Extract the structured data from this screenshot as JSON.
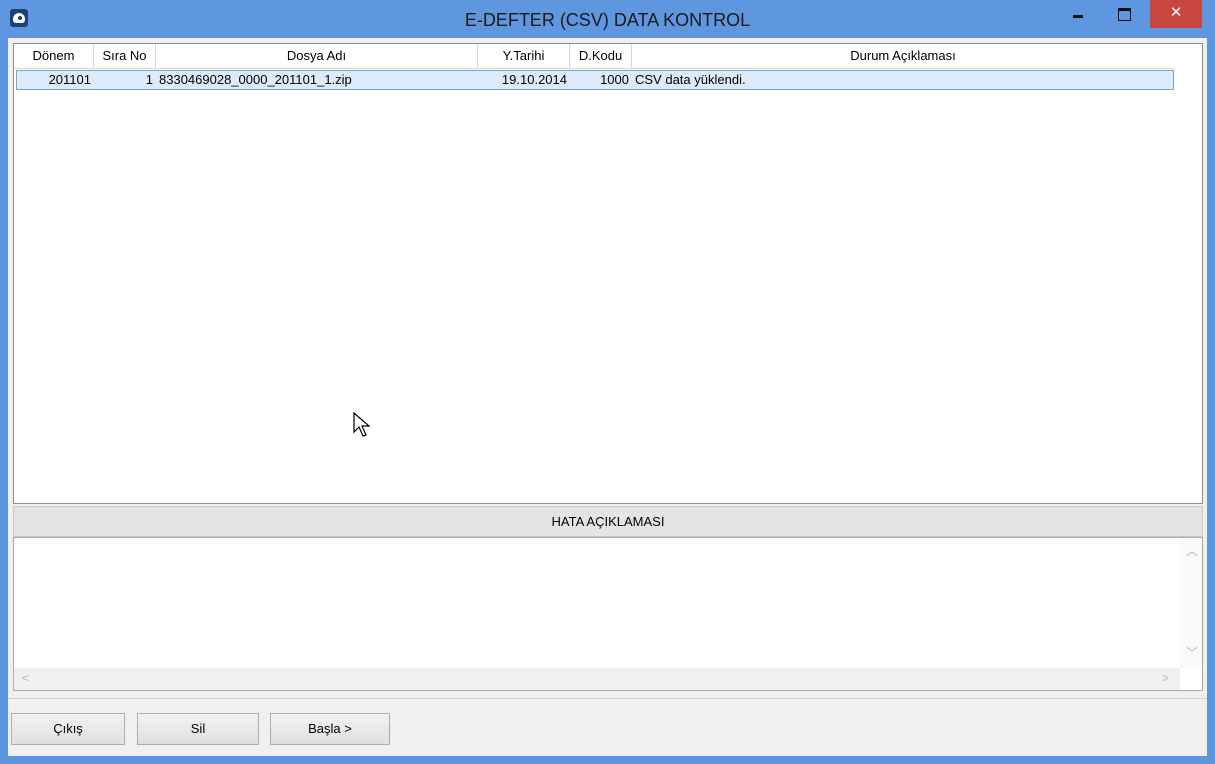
{
  "window": {
    "title": "E-DEFTER (CSV) DATA KONTROL",
    "close_glyph": "✕"
  },
  "grid": {
    "columns": [
      "Dönem",
      "Sıra No",
      "Dosya Adı",
      "Y.Tarihi",
      "D.Kodu",
      "Durum Açıklaması"
    ],
    "rows": [
      {
        "donem": "201101",
        "sira_no": "1",
        "dosya_adi": "8330469028_0000_201101_1.zip",
        "y_tarihi": "19.10.2014",
        "d_kodu": "1000",
        "durum": "CSV data yüklendi."
      }
    ]
  },
  "error_panel": {
    "title": "HATA AÇIKLAMASI",
    "content": ""
  },
  "buttons": {
    "exit": "Çıkış",
    "delete": "Sil",
    "start": "Başla >"
  },
  "colors": {
    "titlebar": "#5e97df",
    "close_button": "#c7463d",
    "selected_row": "#dcebfc"
  },
  "icons": {
    "app": "app-icon",
    "minimize": "minimize-icon",
    "maximize": "maximize-icon",
    "close": "close-icon"
  }
}
